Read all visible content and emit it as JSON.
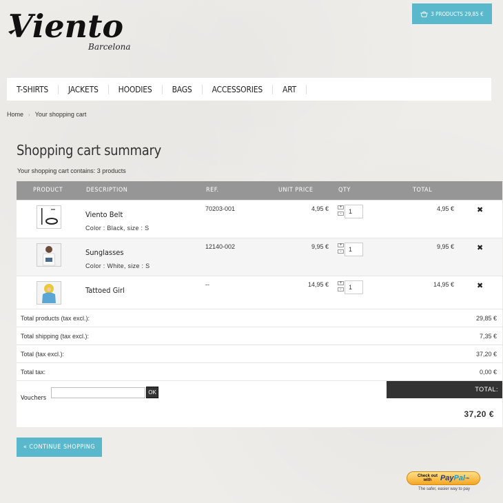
{
  "brand": {
    "name": "Viento",
    "sub": "Barcelona"
  },
  "cart_button": {
    "label": "3 PRODUCTS 29,85 €"
  },
  "nav": [
    "T-SHIRTS",
    "JACKETS",
    "HOODIES",
    "BAGS",
    "ACCESSORIES",
    "ART"
  ],
  "breadcrumb": {
    "home": "Home",
    "current": "Your shopping cart"
  },
  "page": {
    "title": "Shopping cart summary",
    "count": "Your shopping cart contains: 3 products"
  },
  "table": {
    "headers": {
      "product": "PRODUCT",
      "description": "DESCRIPTION",
      "ref": "REF.",
      "unit_price": "UNIT PRICE",
      "qty": "QTY",
      "total": "TOTAL"
    },
    "rows": [
      {
        "name": "Viento Belt",
        "attrs": "Color : Black, size : S",
        "ref": "70203-001",
        "unit_price": "4,95 €",
        "qty": "1",
        "total": "4,95 €"
      },
      {
        "name": "Sunglasses",
        "attrs": "Color : White, size : S",
        "ref": "12140-002",
        "unit_price": "9,95 €",
        "qty": "1",
        "total": "9,95 €"
      },
      {
        "name": "Tattoed Girl",
        "attrs": "",
        "ref": "--",
        "unit_price": "14,95 €",
        "qty": "1",
        "total": "14,95 €"
      }
    ],
    "qty_plus": "+",
    "qty_minus": "-",
    "delete_symbol": "✖"
  },
  "summary": [
    {
      "label": "Total products (tax excl.):",
      "value": "29,85 €"
    },
    {
      "label": "Total shipping (tax excl.):",
      "value": "7,35 €"
    },
    {
      "label": "Total (tax excl.):",
      "value": "37,20 €"
    },
    {
      "label": "Total tax:",
      "value": "0,00 €"
    }
  ],
  "vouchers": {
    "label": "Vouchers",
    "ok": "OK",
    "placeholder": ""
  },
  "total": {
    "label": "TOTAL:",
    "value": "37,20 €"
  },
  "continue_label": "« CONTINUE SHOPPING",
  "paypal": {
    "line1": "Check out",
    "line2": "with",
    "pay": "Pay",
    "pal": "Pal",
    "tagline": "The safer, easier way to pay"
  },
  "colors": {
    "accent": "#5ab8cc",
    "header_grey": "#969696",
    "dark": "#333333"
  }
}
